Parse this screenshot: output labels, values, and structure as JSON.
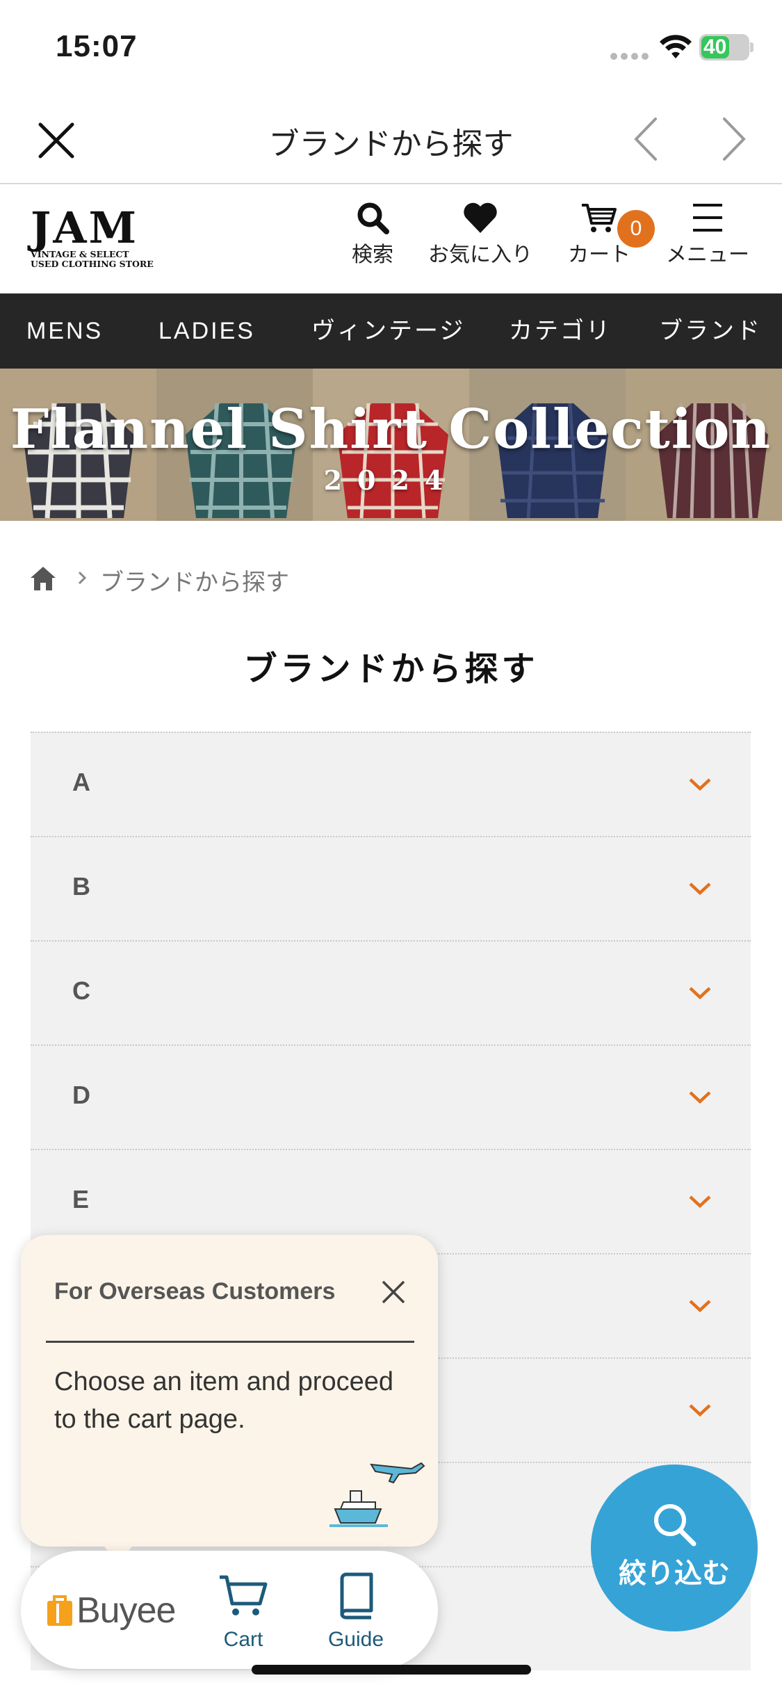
{
  "status_bar": {
    "time": "15:07",
    "battery": "40"
  },
  "browser_nav": {
    "title": "ブランドから探す"
  },
  "header": {
    "logo_main": "JAM",
    "logo_sub_1": "VINTAGE & SELECT",
    "logo_sub_2": "USED CLOTHING STORE",
    "search_label": "検索",
    "favorites_label": "お気に入り",
    "cart_label": "カート",
    "cart_count": "0",
    "menu_label": "メニュー"
  },
  "category_nav": [
    "MENS",
    "LADIES",
    "ヴィンテージ",
    "カテゴリ",
    "ブランド"
  ],
  "banner": {
    "title": "Flannel Shirt Collection",
    "year": "2024"
  },
  "breadcrumb": {
    "current": "ブランドから探す"
  },
  "page_title": "ブランドから探す",
  "accordion": [
    "A",
    "B",
    "C",
    "D",
    "E",
    "",
    "",
    "",
    ""
  ],
  "popup": {
    "title": "For Overseas Customers",
    "body": "Choose an item and proceed to the cart page."
  },
  "buyee_bar": {
    "brand": "Buyee",
    "cart_label": "Cart",
    "guide_label": "Guide"
  },
  "filter_button": {
    "label": "絞り込む"
  },
  "colors": {
    "accent": "#e2711d",
    "nav_dark": "#262626",
    "fab": "#36a3d6",
    "popup_bg": "#fcf4e8",
    "buyee_orange": "#f5a11c"
  }
}
